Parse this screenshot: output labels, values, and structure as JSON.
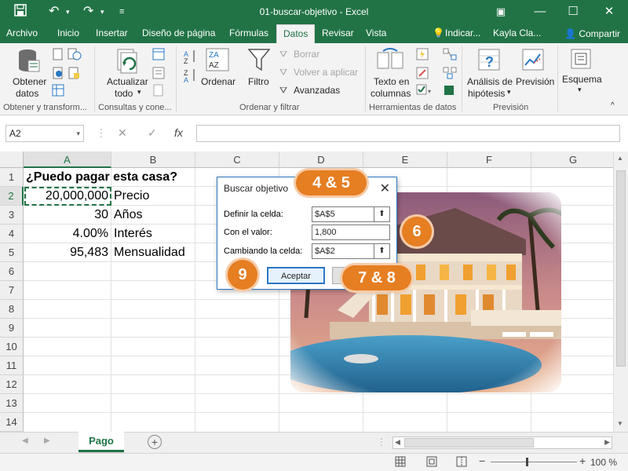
{
  "window": {
    "title": "01-buscar-objetivo  -  Excel",
    "accent": "#217346"
  },
  "tabs": {
    "items": [
      "Archivo",
      "Inicio",
      "Insertar",
      "Diseño de página",
      "Fórmulas",
      "Datos",
      "Revisar",
      "Vista"
    ],
    "active": "Datos",
    "tell_me": "Indicar...",
    "user": "Kayla Cla...",
    "share": "Compartir"
  },
  "ribbon": {
    "get_data": "Obtener",
    "get_data2": "datos",
    "refresh": "Actualizar",
    "refresh2": "todo",
    "sort": "Ordenar",
    "filter": "Filtro",
    "clear": "Borrar",
    "reapply": "Volver a aplicar",
    "advanced": "Avanzadas",
    "text_to_columns": "Texto en",
    "text_to_columns2": "columnas",
    "whatif": "Análisis de",
    "whatif2": "hipótesis",
    "forecast": "Previsión",
    "outline": "Esquema",
    "groups": {
      "get": "Obtener y transform...",
      "queries": "Consultas y cone...",
      "sort_filter": "Ordenar y filtrar",
      "tools": "Herramientas de datos",
      "forecast": "Previsión"
    }
  },
  "formula_bar": {
    "name_box": "A2",
    "cancel": "✕",
    "enter": "✓",
    "fx": "fx",
    "value": ""
  },
  "grid": {
    "columns": [
      "A",
      "B",
      "C",
      "D",
      "E",
      "F",
      "G"
    ],
    "rows": [
      "1",
      "2",
      "3",
      "4",
      "5",
      "6",
      "7",
      "8",
      "9",
      "10",
      "11",
      "12",
      "13",
      "14"
    ],
    "cells": {
      "A1": "¿Puedo pagar esta casa?",
      "A2": "20,000,000",
      "B2": "Precio",
      "A3": "30",
      "B3": "Años",
      "A4": "4.00%",
      "B4": "Interés",
      "A5": "95,483",
      "B5": "Mensualidad"
    }
  },
  "dialog": {
    "title": "Buscar objetivo",
    "set_cell_label": "Definir la celda:",
    "set_cell_value": "$A$5",
    "to_value_label": "Con el valor:",
    "to_value_value": "1,800",
    "changing_label": "Cambiando la celda:",
    "changing_value": "$A$2",
    "ok": "Aceptar",
    "cancel": ""
  },
  "callouts": {
    "c45": "4 & 5",
    "c6": "6",
    "c78": "7 & 8",
    "c9": "9",
    "color": "#e67e22"
  },
  "sheets": {
    "active": "Pago"
  },
  "status": {
    "zoom": "100 %"
  }
}
